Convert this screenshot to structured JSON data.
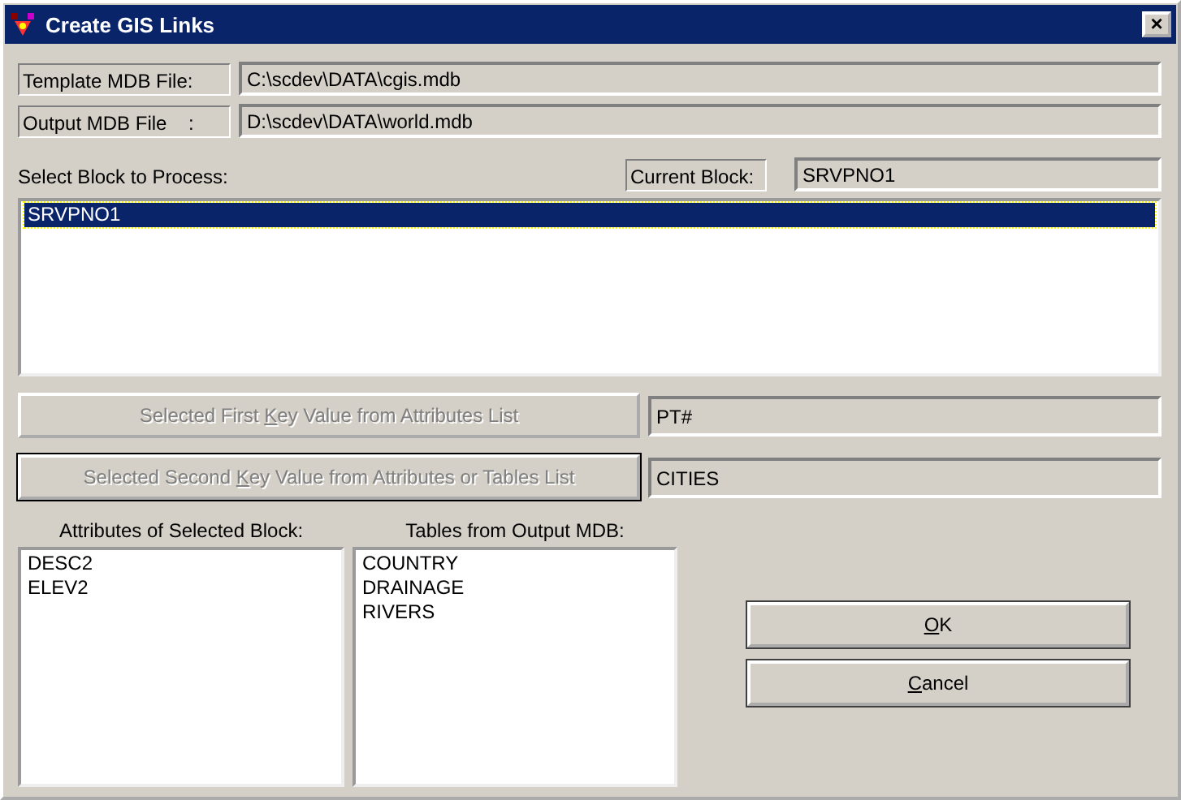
{
  "window": {
    "title": "Create GIS Links",
    "close": "×"
  },
  "files": [
    {
      "label": "Template MDB File:",
      "value": "C:\\scdev\\DATA\\cgis.mdb"
    },
    {
      "label": "Output MDB File    :",
      "value": "D:\\scdev\\DATA\\world.mdb"
    }
  ],
  "block_list": {
    "label": "Select Block to Process:",
    "items": [
      {
        "text": "SRVPNO1",
        "selected": true
      }
    ]
  },
  "current_block": {
    "label": "Current Block:",
    "value": "SRVPNO1"
  },
  "key_rows": [
    {
      "label": {
        "before": "Selected First ",
        "access_key": "K",
        "after": "ey Value from Attributes List"
      },
      "disabled": true,
      "default": false,
      "value": "PT#"
    },
    {
      "label": {
        "before": "Selected Second ",
        "access_key": "K",
        "after": "ey Value from Attributes or Tables List"
      },
      "disabled": true,
      "default": true,
      "value": "CITIES"
    }
  ],
  "attributes": {
    "label": "Attributes of Selected Block:",
    "items": [
      "DESC2",
      "ELEV2"
    ]
  },
  "tables": {
    "label": "Tables from Output MDB:",
    "items": [
      "COUNTRY",
      "DRAINAGE",
      "RIVERS"
    ]
  },
  "buttons": [
    {
      "label": {
        "access_key": "O",
        "after": "K"
      }
    },
    {
      "label": {
        "access_key": "C",
        "after": "ancel"
      }
    }
  ]
}
